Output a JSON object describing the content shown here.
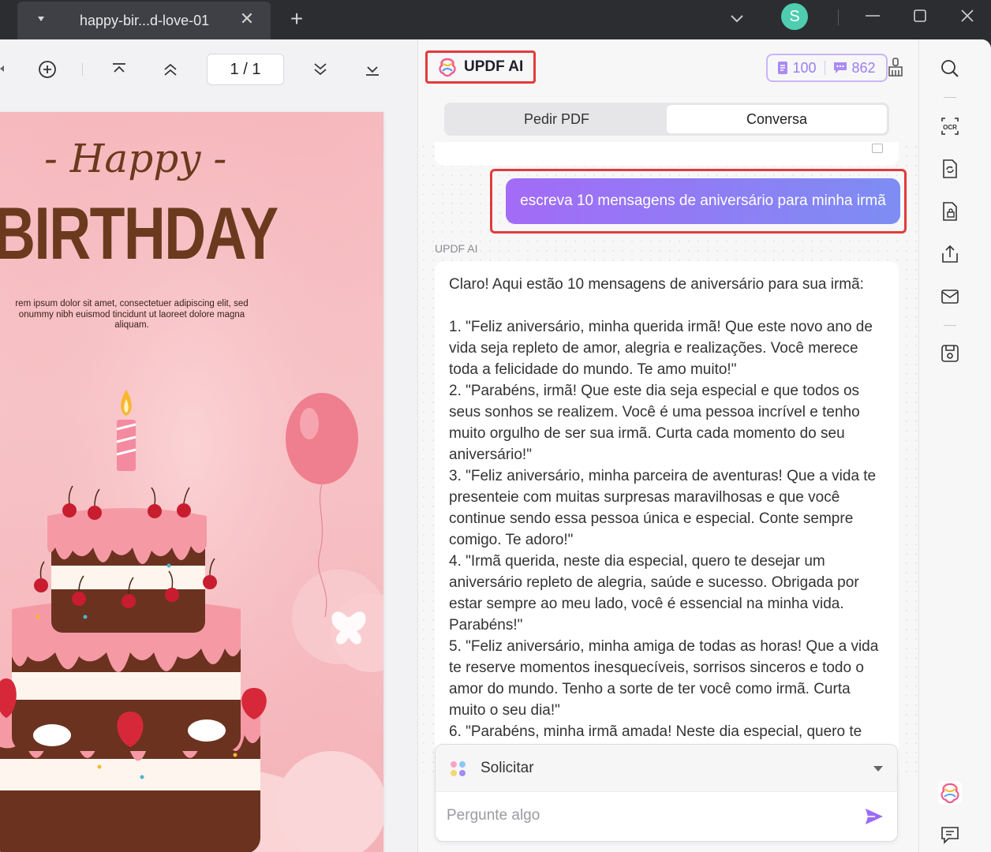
{
  "window": {
    "tab_title": "happy-bir...d-love-01",
    "avatar_initial": "S"
  },
  "viewer": {
    "page_indicator": "1 / 1",
    "pdf": {
      "happy": "- Happy -",
      "birthday": "BIRTHDAY",
      "body_text": "rem ipsum dolor sit amet, consectetuer adipiscing elit, sed\nonummy nibh euismod tincidunt ut laoreet dolore magna\naliquam."
    }
  },
  "ai_panel": {
    "title": "UPDF AI",
    "credits": {
      "documents": "100",
      "messages": "862"
    },
    "tabs": [
      {
        "label": "Pedir PDF",
        "active": false
      },
      {
        "label": "Conversa",
        "active": true
      }
    ],
    "user_message": "escreva 10 mensagens de aniversário para minha irmã",
    "ai_label": "UPDF AI",
    "ai_response": "Claro! Aqui estão 10 mensagens de aniversário para sua irmã:\n\n1. \"Feliz aniversário, minha querida irmã! Que este novo ano de vida seja repleto de amor, alegria e realizações. Você merece toda a felicidade do mundo. Te amo muito!\"\n2. \"Parabéns, irmã! Que este dia seja especial e que todos os seus sonhos se realizem. Você é uma pessoa incrível e tenho muito orgulho de ser sua irmã. Curta cada momento do seu aniversário!\"\n3. \"Feliz aniversário, minha parceira de aventuras! Que a vida te presenteie com muitas surpresas maravilhosas e que você continue sendo essa pessoa única e especial. Conte sempre comigo. Te adoro!\"\n4. \"Irmã querida, neste dia especial, quero te desejar um aniversário repleto de alegria, saúde e sucesso. Obrigada por estar sempre ao meu lado, você é essencial na minha vida. Parabéns!\"\n5. \"Feliz aniversário, minha amiga de todas as horas! Que a vida te reserve momentos inesquecíveis, sorrisos sinceros e todo o amor do mundo. Tenho a sorte de ter você como irmã. Curta muito o seu dia!\"\n6. \"Parabéns, minha irmã amada! Neste dia especial, quero te",
    "composer": {
      "mode_label": "Solicitar",
      "placeholder": "Pergunte algo"
    }
  },
  "colors": {
    "accent_purple": "#9c7df0",
    "highlight_red": "#e23b3b",
    "avatar_green": "#4ecdb0"
  }
}
